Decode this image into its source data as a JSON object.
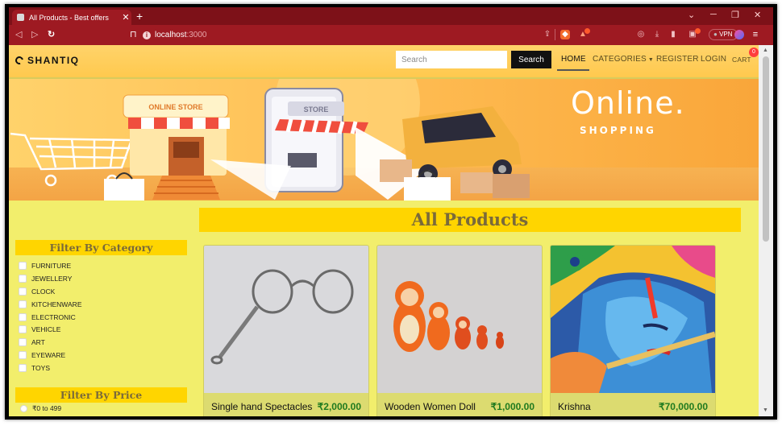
{
  "browser": {
    "tab_title": "All Products - Best offers",
    "tab_close": "✕",
    "new_tab": "+",
    "url_host": "localhost",
    "url_port": ":3000",
    "vpn_label": "VPN",
    "accent": "#9e1a22"
  },
  "navbar": {
    "logo": "SHANTIQ",
    "search_placeholder": "Search",
    "search_button": "Search",
    "links": {
      "home": "HOME",
      "categories": "CATEGORIES",
      "register": "REGISTER",
      "login": "LOGIN",
      "cart": "CART"
    },
    "cart_count": "0"
  },
  "banner": {
    "headline": "Online.",
    "subline": "SHOPPING",
    "store_sign": "ONLINE STORE",
    "phone_sign": "STORE"
  },
  "main": {
    "title": "All Products"
  },
  "filters": {
    "category_title": "Filter By Category",
    "categories": [
      "FURNITURE",
      "JEWELLERY",
      "CLOCK",
      "KITCHENWARE",
      "ELECTRONIC",
      "VEHICLE",
      "ART",
      "EYEWARE",
      "TOYS"
    ],
    "price_title": "Filter By Price",
    "price_first": "₹0 to 499"
  },
  "products": [
    {
      "name": "Single hand Spectacles",
      "price": "₹2,000.00"
    },
    {
      "name": "Wooden Women Doll",
      "price": "₹1,000.00"
    },
    {
      "name": "Krishna",
      "price": "₹70,000.00"
    }
  ],
  "colors": {
    "page_bg": "#f2ee6c",
    "title_bar": "#ffd500",
    "price_green": "#1f7a1f"
  }
}
